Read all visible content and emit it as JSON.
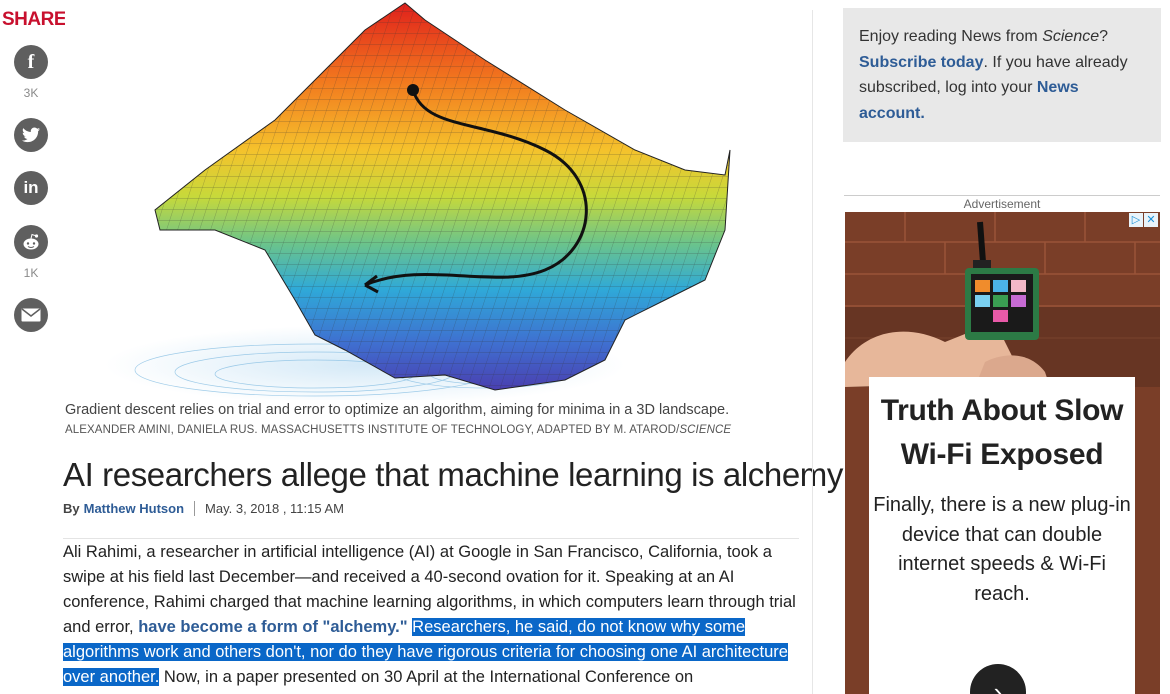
{
  "share": {
    "title": "SHARE",
    "facebook_count": "3K",
    "reddit_count": "1K"
  },
  "article": {
    "caption": "Gradient descent relies on trial and error to optimize an algorithm, aiming for minima in a 3D landscape.",
    "credit_prefix": "ALEXANDER AMINI, DANIELA RUS. MASSACHUSETTS INSTITUTE OF TECHNOLOGY, ADAPTED BY M. ATAROD/",
    "credit_source": "SCIENCE",
    "headline": "AI researchers allege that machine learning is alchemy",
    "by": "By",
    "author": "Matthew Hutson",
    "date": "May. 3, 2018 , 11:15 AM",
    "body_1": "Ali Rahimi, a researcher in artificial intelligence (AI) at Google in San Francisco, California, took a swipe at his field last December—and received a 40-second ovation for it. Speaking at an AI conference, Rahimi charged that machine learning algorithms, in which computers learn through trial and error, ",
    "body_link": "have become a form of \"alchemy.\"",
    "body_selected": "Researchers, he said, do not know why some algorithms work and others don't, nor do they have rigorous criteria for choosing one AI architecture over another.",
    "body_2": " Now, in a paper presented on 30 April at the International Conference on"
  },
  "promo": {
    "text_1": "Enjoy reading News from ",
    "text_1_em": "Science",
    "text_1_end": "?",
    "subscribe_link": "Subscribe today",
    "text_2": ". If you have already subscribed, log into your ",
    "account_link": "News account."
  },
  "ad": {
    "label": "Advertisement",
    "headline": "Truth About Slow Wi-Fi Exposed",
    "sub": "Finally, there is a new plug-in device that can double internet speeds & Wi-Fi reach."
  }
}
